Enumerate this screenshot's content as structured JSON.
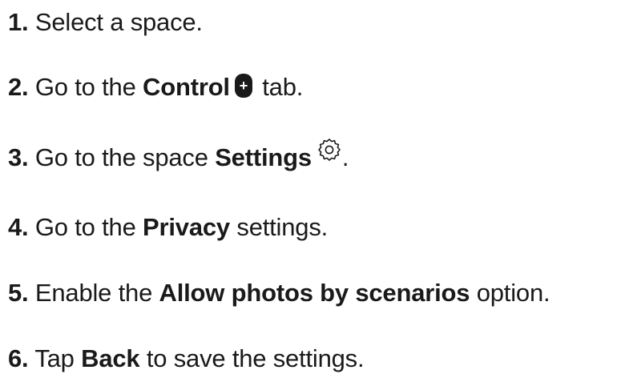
{
  "steps": [
    {
      "num": "1.",
      "text": "Select a space."
    },
    {
      "num": "2.",
      "pre": "Go to the",
      "bold": "Control",
      "post": "tab.",
      "icon": "control-plus-icon"
    },
    {
      "num": "3.",
      "pre": "Go to the space",
      "bold": "Settings",
      "post": ".",
      "icon": "gear-icon"
    },
    {
      "num": "4.",
      "pre": "Go to the",
      "bold": "Privacy",
      "post": "settings."
    },
    {
      "num": "5.",
      "pre": "Enable the",
      "bold": "Allow photos by scenarios",
      "post": "option."
    },
    {
      "num": "6.",
      "pre": "Tap",
      "bold": "Back",
      "post": "to save the settings."
    }
  ],
  "icons": {
    "control_symbol": "+"
  },
  "colors": {
    "text": "#1a1a1a",
    "background": "#ffffff"
  }
}
